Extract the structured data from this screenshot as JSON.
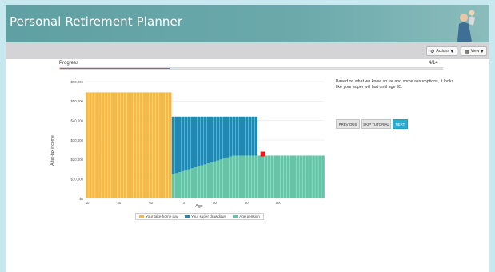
{
  "app": {
    "title": "Personal Retirement Planner"
  },
  "toolbar": {
    "actions_label": "Actions",
    "view_label": "View"
  },
  "progress": {
    "label": "Progress",
    "count": "4/14",
    "fraction": 0.2857
  },
  "info": {
    "text": "Based on what we know so far and some assumptions, it looks like your super will last until age 95."
  },
  "buttons": {
    "previous": "PREVIOUS",
    "skip": "SKIP TUTORIAL",
    "next": "NEXT"
  },
  "colors": {
    "take_home": "#f8b942",
    "super_drawdown": "#1b8ab7",
    "age_pension": "#62c6a6",
    "marker": "#e32020",
    "header": "#6ba9ab"
  },
  "chart_data": {
    "type": "bar",
    "ylabel": "After-tax income",
    "xlabel": "Age",
    "ylim": [
      0,
      60000
    ],
    "xlim": [
      40,
      115
    ],
    "ytick_labels": [
      "$0",
      "$10,000",
      "$20,000",
      "$30,000",
      "$40,000",
      "$50,000",
      "$60,000"
    ],
    "xtick_labels": [
      "40",
      "50",
      "60",
      "70",
      "80",
      "90",
      "100"
    ],
    "series": [
      {
        "name": "Your take-home pay",
        "ages": [
          40,
          66
        ],
        "value": 54500
      },
      {
        "name": "Your super drawdown",
        "ages": [
          67,
          93
        ],
        "total": 42000
      },
      {
        "name": "Age pension",
        "ages": [
          67,
          114
        ],
        "start": 12500,
        "plateau": 22000,
        "plateau_age": 86
      }
    ],
    "marker": {
      "age": 95,
      "value": 22800
    },
    "legend": "bottom"
  }
}
